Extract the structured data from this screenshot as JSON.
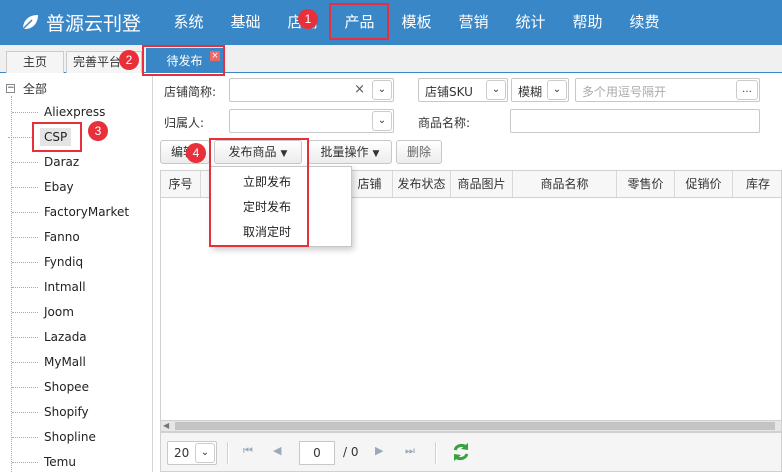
{
  "app": {
    "title": "普源云刊登"
  },
  "nav": {
    "items": [
      "系统",
      "基础",
      "店铺",
      "产品",
      "模板",
      "营销",
      "统计",
      "帮助",
      "续费"
    ]
  },
  "tabs": [
    {
      "label": "主页"
    },
    {
      "label": "完善平台"
    },
    {
      "label": "待发布",
      "close": "×"
    }
  ],
  "tree": {
    "root": "全部",
    "expander": "⊟",
    "items": [
      "Aliexpress",
      "CSP",
      "Daraz",
      "Ebay",
      "FactoryMarket",
      "Fanno",
      "Fyndiq",
      "Intmall",
      "Joom",
      "Lazada",
      "MyMall",
      "Shopee",
      "Shopify",
      "Shopline",
      "Temu"
    ]
  },
  "filters": {
    "shop_short_label": "店铺简称:",
    "owner_label": "归属人:",
    "sku_select": "店铺SKU",
    "match_select": "模糊",
    "multi_placeholder": "多个用逗号隔开",
    "more_button": "…",
    "product_name_label": "商品名称:"
  },
  "toolbar": {
    "edit": "编辑",
    "publish": "发布商品",
    "batch": "批量操作",
    "delete": "删除"
  },
  "publish_menu": [
    "立即发布",
    "定时发布",
    "取消定时"
  ],
  "grid": {
    "columns": [
      "序号",
      "",
      "店铺",
      "发布状态",
      "商品图片",
      "商品名称",
      "零售价",
      "促销价",
      "库存"
    ]
  },
  "pager": {
    "page_size": "20",
    "current_page": "0",
    "total": "/ 0"
  },
  "annotations": [
    "1",
    "2",
    "3",
    "4"
  ],
  "colors": {
    "topbar": "#3a87c8",
    "highlight": "#e8303a"
  }
}
